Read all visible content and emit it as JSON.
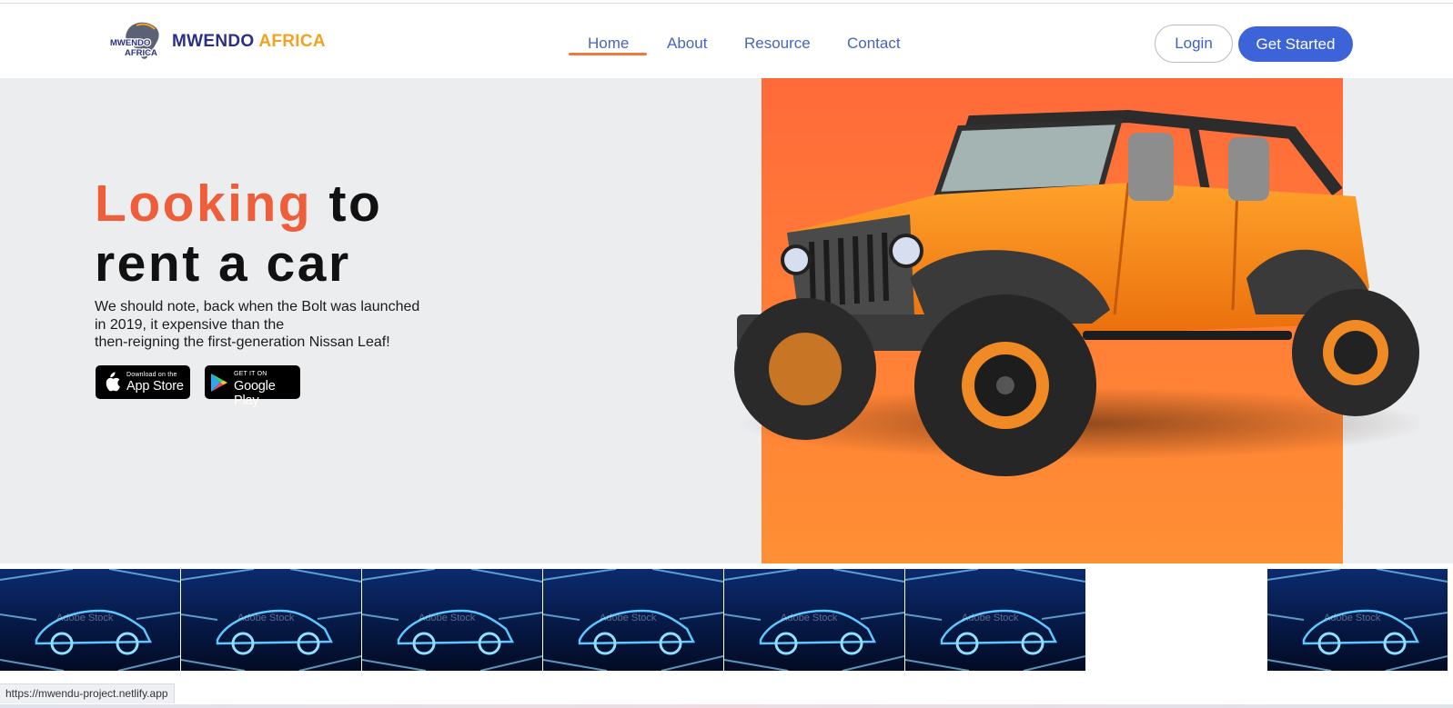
{
  "brand": {
    "logo_text_top": "MWENDO",
    "logo_text_bottom": "AFRICA",
    "name_part1": "MWENDO",
    "name_part2": "AFRICA",
    "name_color": "#2d2f86",
    "accent_color": "#f0a322"
  },
  "nav": {
    "items": [
      {
        "label": "Home",
        "active": true
      },
      {
        "label": "About",
        "active": false
      },
      {
        "label": "Resource",
        "active": false
      },
      {
        "label": "Contact",
        "active": false
      }
    ],
    "active_underline_color": "#f07a3d",
    "link_color": "#4763c4"
  },
  "auth": {
    "login_label": "Login",
    "get_started_label": "Get Started",
    "primary_color": "#3d63d9"
  },
  "hero": {
    "title_accent": "Looking",
    "title_rest_line1": "to",
    "title_line2": "rent a car",
    "accent_color": "#ef5e3b",
    "paragraph_line1": "We should note, back when the Bolt was launched",
    "paragraph_line2": "in 2019, it expensive than the",
    "paragraph_line3": "then-reigning the first-generation Nissan Leaf!",
    "panel_color": "#ff7c37",
    "image_icon": "orange-jeep-image"
  },
  "stores": {
    "app_store": {
      "small": "Download on the",
      "big": "App Store",
      "icon": "apple-icon"
    },
    "google_play": {
      "small": "GET IT ON",
      "big": "Google Play",
      "icon": "google-play-icon"
    }
  },
  "gallery": {
    "watermark": "Adobe Stock",
    "tile_icon": "neon-car-image"
  },
  "status_bar": {
    "url": "https://mwendu-project.netlify.app"
  }
}
